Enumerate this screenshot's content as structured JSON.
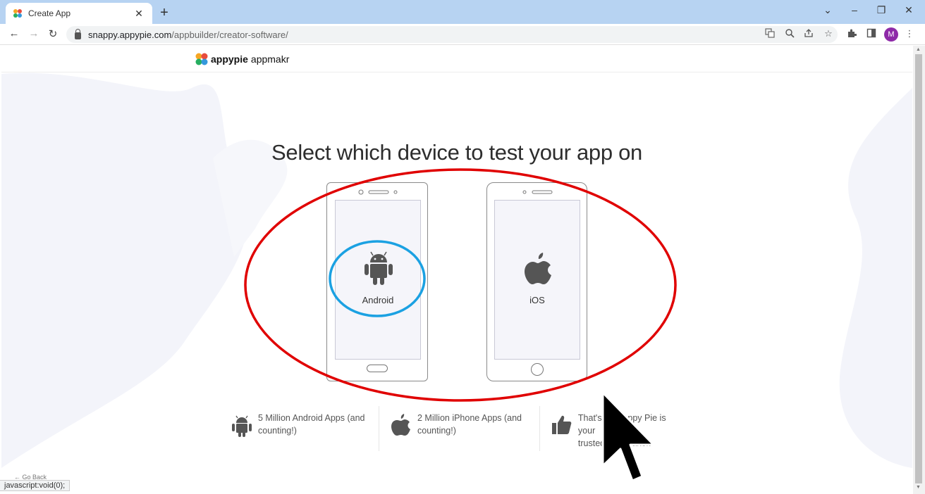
{
  "browser": {
    "tab_title": "Create App",
    "tab_close": "✕",
    "new_tab": "+",
    "url_host": "snappy.appypie.com",
    "url_path": "/appbuilder/creator-software/",
    "avatar_letter": "M",
    "window_controls": {
      "dropdown": "⌄",
      "minimize": "–",
      "restore": "❐",
      "close": "✕"
    }
  },
  "header": {
    "brand_bold": "appypie",
    "brand_light": "appmakr"
  },
  "main": {
    "heading": "Select which device to test your app on",
    "devices": [
      {
        "label": "Android",
        "icon": "android-icon"
      },
      {
        "label": "iOS",
        "icon": "apple-icon"
      }
    ]
  },
  "features": [
    {
      "icon": "android-icon",
      "line1": "5 Million Android Apps (and",
      "line2": "counting!)"
    },
    {
      "icon": "apple-icon",
      "line1": "2 Million iPhone Apps (and",
      "line2": "counting!)"
    },
    {
      "icon": "thumbs-up-icon",
      "line1": "That's why Appy Pie is your",
      "line2": "trusted app maker."
    }
  ],
  "footer": {
    "go_back": "← Go Back"
  },
  "status_bar": "javascript:void(0);",
  "annotations": {
    "ellipse_color": "#e00000",
    "circle_color": "#1ba1e2"
  }
}
